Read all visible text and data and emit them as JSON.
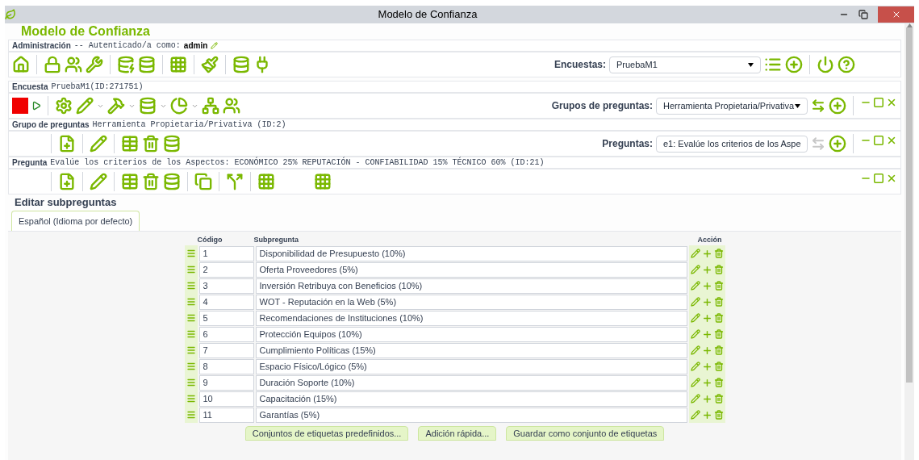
{
  "window": {
    "title": "Modelo de Confianza"
  },
  "app_title": "Modelo de Confianza",
  "admin": {
    "label": "Administración",
    "text": "-- Autenticado/a como:",
    "user": "admin",
    "select_label": "Encuestas:",
    "select_value": "PruebaM1"
  },
  "survey": {
    "label": "Encuesta",
    "text": "PruebaM1(ID:271751)",
    "select_label": "Grupos de preguntas:",
    "select_value": "Herramienta Propietaria/Privativa",
    "nav_enabled": true
  },
  "group": {
    "label": "Grupo de preguntas",
    "text": "Herramienta Propietaria/Privativa (ID:2)",
    "select_label": "Preguntas:",
    "select_value": "e1: Evalúe los criterios de los Aspe",
    "nav_enabled": false
  },
  "question": {
    "label": "Pregunta",
    "text": "Evalúe los criterios de los Aspectos: ECONÓMICO 25%  REPUTACIÓN -  CONFIABILIDAD 15% TÉCNICO 60% (ID:21)"
  },
  "heading": "Editar subpreguntas",
  "tabs": [
    {
      "label": "Español (Idioma por defecto)",
      "selected": true
    }
  ],
  "table": {
    "columns": [
      "Código",
      "Subpregunta",
      "Acción"
    ],
    "rows": [
      {
        "code": "1",
        "text": "Disponibilidad de Presupuesto (10%)"
      },
      {
        "code": "2",
        "text": "Oferta Proveedores (5%)"
      },
      {
        "code": "3",
        "text": "Inversión Retribuya con Beneficios (10%)"
      },
      {
        "code": "4",
        "text": "WOT - Reputación en la Web (5%)"
      },
      {
        "code": "5",
        "text": "Recomendaciones de Instituciones (10%)"
      },
      {
        "code": "6",
        "text": "Protección Equipos (10%)"
      },
      {
        "code": "7",
        "text": "Cumplimiento Políticas (15%)"
      },
      {
        "code": "8",
        "text": "Espacio Físico/Lógico (5%)"
      },
      {
        "code": "9",
        "text": "Duración Soporte (10%)"
      },
      {
        "code": "10",
        "text": "Capacitación (15%)"
      },
      {
        "code": "11",
        "text": "Garantías (5%)"
      }
    ]
  },
  "buttons": [
    "Conjuntos de etiquetas predefinidos...",
    "Adición rápida...",
    "Guardar como conjunto de etiquetas"
  ]
}
